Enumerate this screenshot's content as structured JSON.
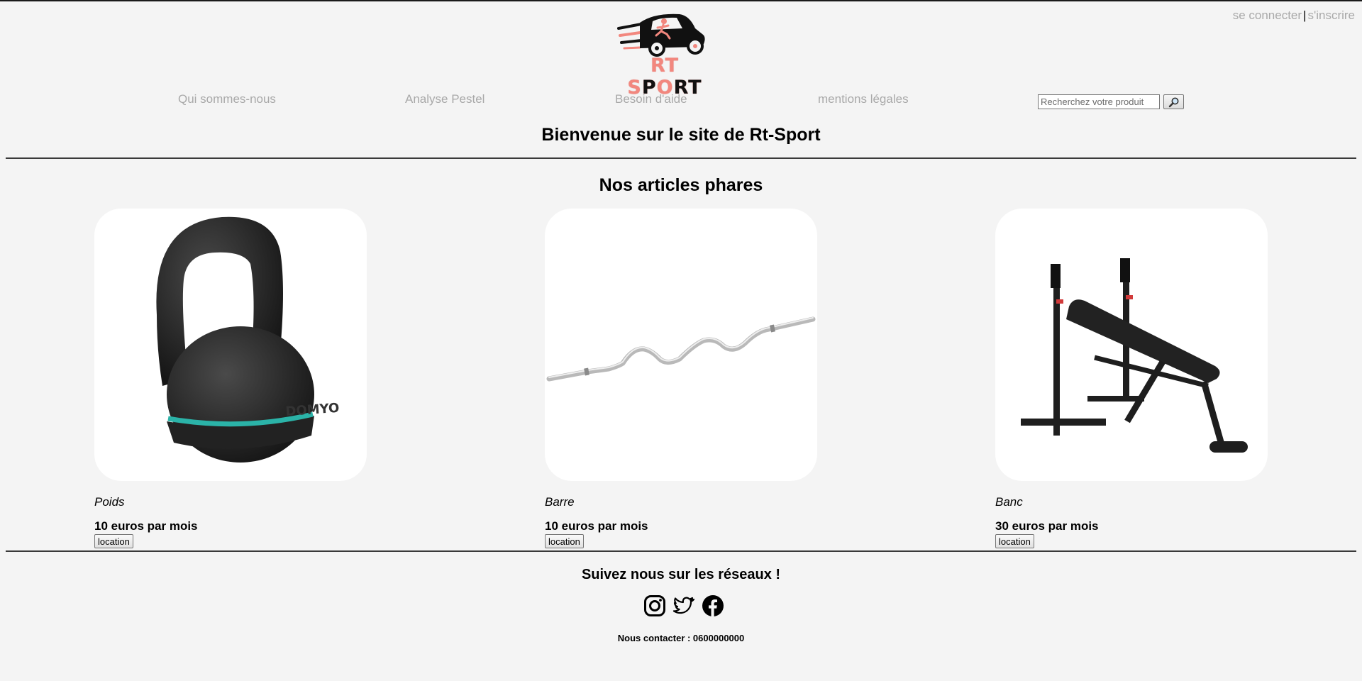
{
  "auth": {
    "login": "se connecter",
    "separator": "|",
    "signup": "s'inscrire"
  },
  "logo": {
    "brand_rt": "RT",
    "brand_s": "S",
    "brand_p": "P",
    "brand_o": "O",
    "brand_rt2": "RT"
  },
  "nav": {
    "items": [
      {
        "label": "Qui sommes-nous"
      },
      {
        "label": "Analyse Pestel"
      },
      {
        "label": "Besoin d'aide"
      },
      {
        "label": "mentions légales"
      }
    ],
    "search_placeholder": "Recherchez votre produit",
    "search_icon": "magnifier-icon"
  },
  "welcome": "Bienvenue sur le site de Rt-Sport",
  "featured_title": "Nos articles phares",
  "products": [
    {
      "name": "Poids",
      "price": "10 euros par mois",
      "button": "location",
      "image": "kettlebell"
    },
    {
      "name": "Barre",
      "price": "10 euros par mois",
      "button": "location",
      "image": "curl-bar"
    },
    {
      "name": "Banc",
      "price": "30 euros par mois",
      "button": "location",
      "image": "weight-bench"
    }
  ],
  "footer": {
    "follow": "Suivez nous sur les réseaux !",
    "socials": [
      "instagram-icon",
      "twitter-icon",
      "facebook-icon"
    ],
    "contact": "Nous contacter : 0600000000"
  },
  "colors": {
    "background": "#f4f4f4",
    "link_gray": "#a9a9a9",
    "brand_salmon": "#f2877e",
    "kettlebell_accent": "#2bb3a8"
  }
}
